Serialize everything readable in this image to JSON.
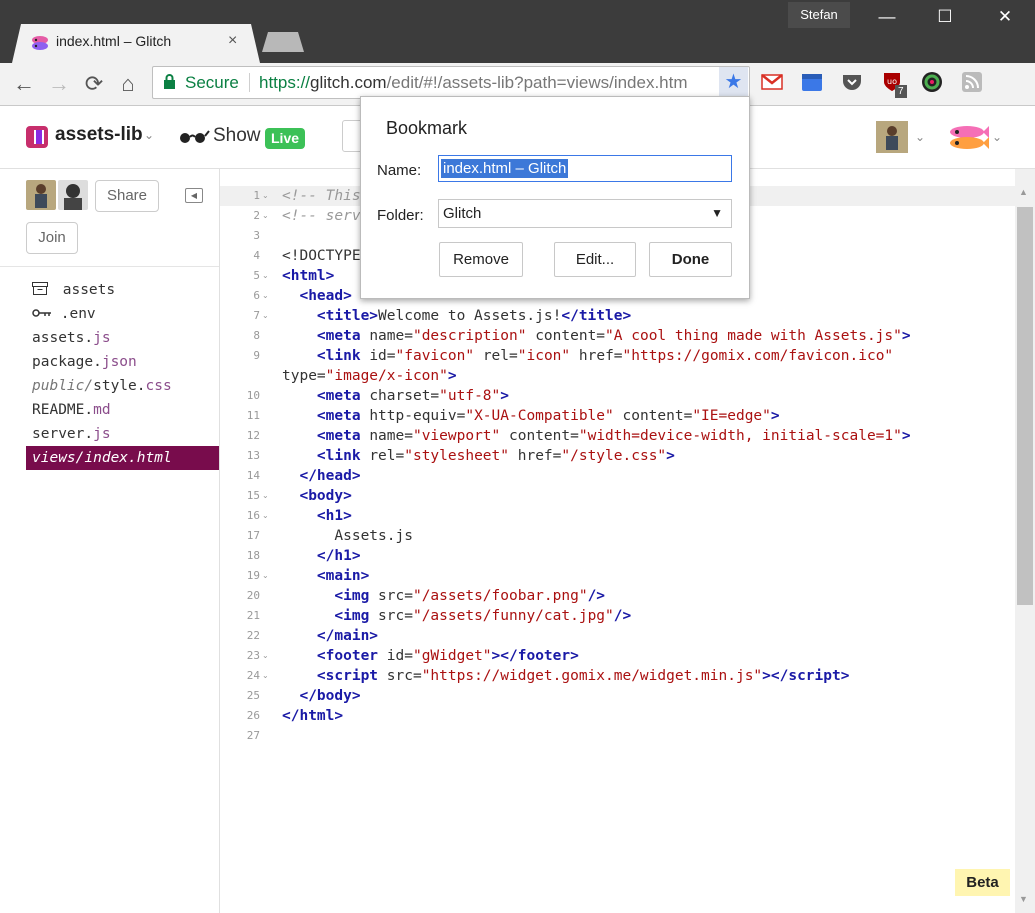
{
  "browser": {
    "tab_title": "index.html – Glitch",
    "tab_close": "×",
    "profile_name": "Stefan",
    "window_controls": {
      "minimize": "—",
      "maximize": "☐",
      "close": "✕"
    },
    "nav": {
      "back": "←",
      "forward": "→",
      "reload": "⟳",
      "home": "⌂"
    },
    "omnibox": {
      "secure_label": "Secure",
      "url_protocol": "https://",
      "url_host": "glitch.com",
      "url_path": "/edit/#!/assets-lib?path=views/index.htm",
      "star": "★"
    },
    "extensions": [
      "gmail-icon",
      "calendar-icon",
      "pocket-icon",
      "ublock-icon",
      "color-picker-icon",
      "rss-icon"
    ],
    "ublock_badge": "7"
  },
  "app": {
    "project_name": "assets-lib",
    "dropdown_caret": "⌄",
    "show_label": "Show",
    "live_badge": "Live",
    "share_label": "Share",
    "join_label": "Join"
  },
  "files": [
    {
      "name": "assets",
      "prefix": "",
      "ext": "",
      "italic": false
    },
    {
      "name": ".env",
      "prefix": "",
      "ext": "",
      "italic": false
    },
    {
      "name": "assets.",
      "ext": "js",
      "italic": false
    },
    {
      "name": "package.",
      "ext": "json",
      "italic": false
    },
    {
      "name": "public/style.",
      "ext": "css",
      "italic": true
    },
    {
      "name": "README.",
      "ext": "md",
      "italic": false
    },
    {
      "name": "server.",
      "ext": "js",
      "italic": false
    },
    {
      "name": "views/index.html",
      "ext": "",
      "italic": true,
      "selected": true
    }
  ],
  "editor": {
    "line_numbers": [
      "1",
      "2",
      "3",
      "4",
      "5",
      "6",
      "7",
      "8",
      "9",
      "10",
      "11",
      "12",
      "13",
      "14",
      "15",
      "16",
      "17",
      "18",
      "19",
      "20",
      "21",
      "22",
      "23",
      "24",
      "25",
      "26",
      "27"
    ],
    "fold_marker": "⌄",
    "beta_label": "Beta"
  },
  "bookmark": {
    "title": "Bookmark",
    "name_label": "Name:",
    "name_value": "index.html – Glitch",
    "folder_label": "Folder:",
    "folder_value": "Glitch",
    "folder_caret": "▼",
    "remove_label": "Remove",
    "edit_label": "Edit...",
    "done_label": "Done"
  }
}
